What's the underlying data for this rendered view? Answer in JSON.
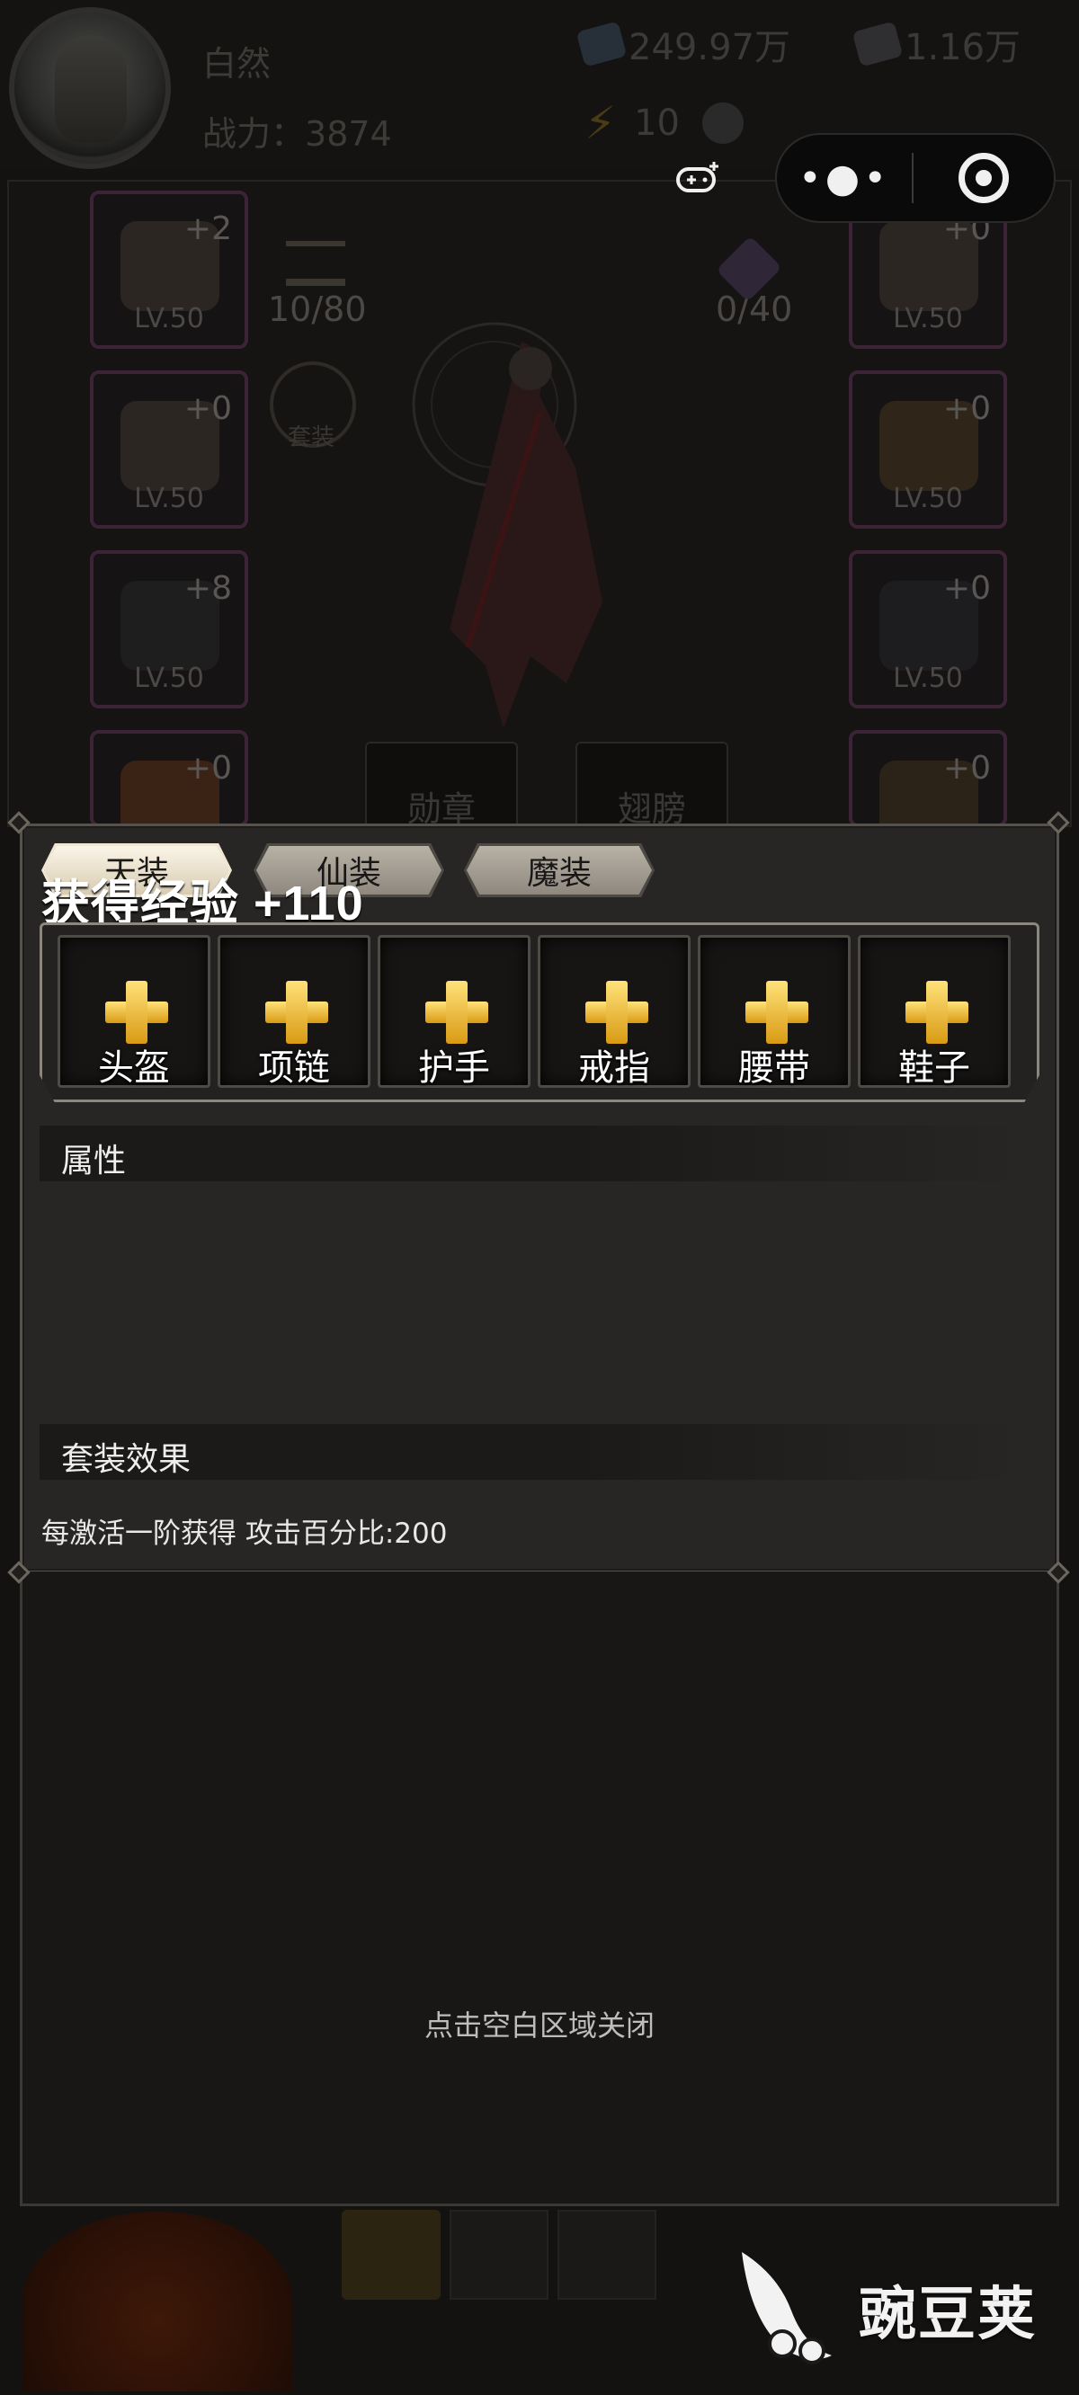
{
  "player": {
    "name": "白然",
    "power_label": "战力：",
    "power_value": "3874",
    "gem_amount": "249.97万",
    "ore_amount": "1.16万",
    "energy": "10"
  },
  "equipment": {
    "left_slots": [
      {
        "level": "LV.50",
        "plus": "+2"
      },
      {
        "level": "LV.50",
        "plus": "+0"
      },
      {
        "level": "LV.50",
        "plus": "+8"
      },
      {
        "level": "",
        "plus": "+0"
      }
    ],
    "right_slots": [
      {
        "level": "LV.50",
        "plus": "+0"
      },
      {
        "level": "LV.50",
        "plus": "+0"
      },
      {
        "level": "LV.50",
        "plus": "+0"
      },
      {
        "level": "",
        "plus": "+0"
      }
    ],
    "forge_counter": "10/80",
    "crest_counter": "0/40",
    "set_badge": "套装",
    "medal_button": "勋章",
    "wings_button": "翅膀"
  },
  "panel": {
    "tabs": [
      {
        "label": "天装",
        "active": true
      },
      {
        "label": "仙装",
        "active": false
      },
      {
        "label": "魔装",
        "active": false
      }
    ],
    "toast": "获得经验 +110",
    "slots": [
      {
        "label": "头盔"
      },
      {
        "label": "项链"
      },
      {
        "label": "护手"
      },
      {
        "label": "戒指"
      },
      {
        "label": "腰带"
      },
      {
        "label": "鞋子"
      }
    ],
    "attributes_header": "属性",
    "set_effect_header": "套装效果",
    "set_effect_text": "每激活一阶获得 攻击百分比:200"
  },
  "close_hint": "点击空白区域关闭",
  "watermark": "豌豆荚",
  "colors": {
    "gold_plus": "#f2b52c",
    "active_tab": "#efe6d3",
    "panel_bg": "#282624"
  }
}
